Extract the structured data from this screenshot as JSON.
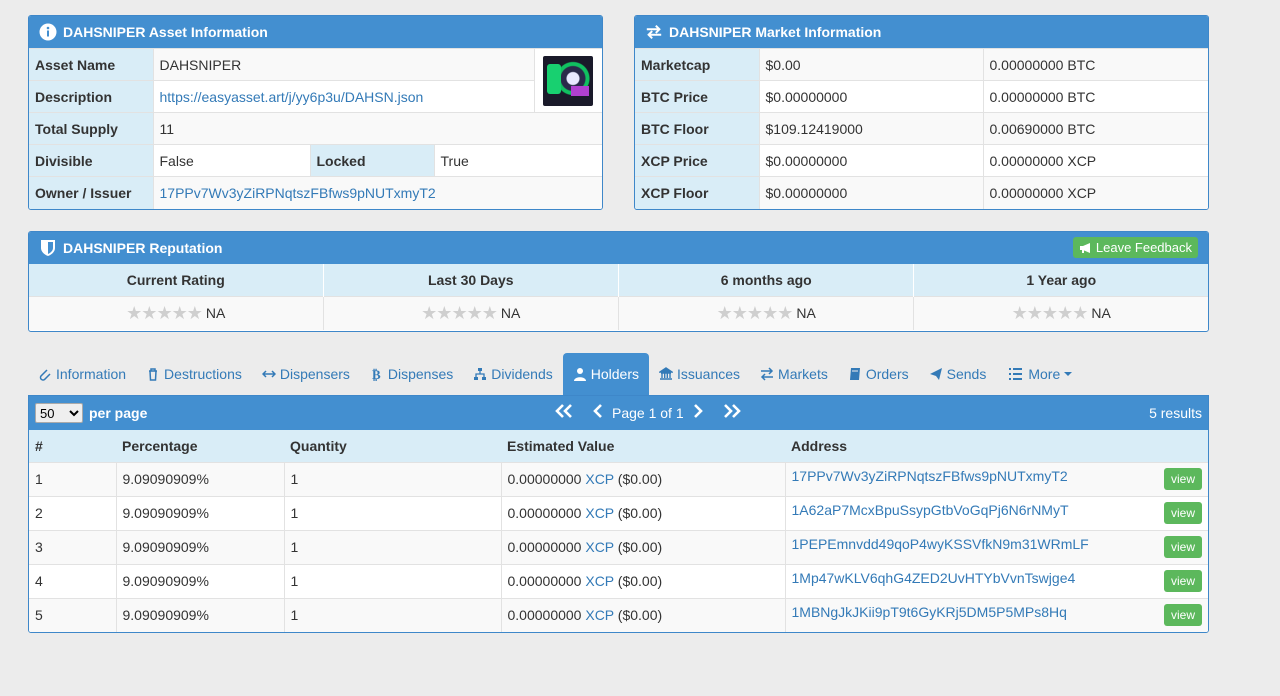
{
  "asset": {
    "title": "DAHSNIPER Asset Information",
    "rows": {
      "name_label": "Asset Name",
      "name": "DAHSNIPER",
      "desc_label": "Description",
      "desc": "https://easyasset.art/j/yy6p3u/DAHSN.json",
      "supply_label": "Total Supply",
      "supply": "11",
      "divisible_label": "Divisible",
      "divisible": "False",
      "locked_label": "Locked",
      "locked": "True",
      "owner_label": "Owner / Issuer",
      "owner": "17PPv7Wv3yZiRPNqtszFBfws9pNUTxmyT2"
    }
  },
  "market": {
    "title": "DAHSNIPER Market Information",
    "rows": [
      {
        "label": "Marketcap",
        "usd": "$0.00",
        "alt": "0.00000000 BTC"
      },
      {
        "label": "BTC Price",
        "usd": "$0.00000000",
        "alt": "0.00000000 BTC"
      },
      {
        "label": "BTC Floor",
        "usd": "$109.12419000",
        "alt": "0.00690000 BTC"
      },
      {
        "label": "XCP Price",
        "usd": "$0.00000000",
        "alt": "0.00000000 XCP"
      },
      {
        "label": "XCP Floor",
        "usd": "$0.00000000",
        "alt": "0.00000000 XCP"
      }
    ]
  },
  "reputation": {
    "title": "DAHSNIPER Reputation",
    "feedback_label": "Leave Feedback",
    "columns": [
      "Current Rating",
      "Last 30 Days",
      "6 months ago",
      "1 Year ago"
    ],
    "values": [
      "NA",
      "NA",
      "NA",
      "NA"
    ]
  },
  "tabs": [
    "Information",
    "Destructions",
    "Dispensers",
    "Dispenses",
    "Dividends",
    "Holders",
    "Issuances",
    "Markets",
    "Orders",
    "Sends",
    "More"
  ],
  "holders": {
    "per_page_value": "50",
    "per_page_label": "per page",
    "page_label": "Page 1 of 1",
    "results": "5 results",
    "headers": [
      "#",
      "Percentage",
      "Quantity",
      "Estimated Value",
      "Address"
    ],
    "view_label": "view",
    "rows": [
      {
        "n": "1",
        "pct": "9.09090909%",
        "qty": "1",
        "val": "0.00000000",
        "asset": "XCP",
        "usd": "($0.00)",
        "addr": "17PPv7Wv3yZiRPNqtszFBfws9pNUTxmyT2"
      },
      {
        "n": "2",
        "pct": "9.09090909%",
        "qty": "1",
        "val": "0.00000000",
        "asset": "XCP",
        "usd": "($0.00)",
        "addr": "1A62aP7McxBpuSsypGtbVoGqPj6N6rNMyT"
      },
      {
        "n": "3",
        "pct": "9.09090909%",
        "qty": "1",
        "val": "0.00000000",
        "asset": "XCP",
        "usd": "($0.00)",
        "addr": "1PEPEmnvdd49qoP4wyKSSVfkN9m31WRmLF"
      },
      {
        "n": "4",
        "pct": "9.09090909%",
        "qty": "1",
        "val": "0.00000000",
        "asset": "XCP",
        "usd": "($0.00)",
        "addr": "1Mp47wKLV6qhG4ZED2UvHTYbVvnTswjge4"
      },
      {
        "n": "5",
        "pct": "9.09090909%",
        "qty": "1",
        "val": "0.00000000",
        "asset": "XCP",
        "usd": "($0.00)",
        "addr": "1MBNgJkJKii9pT9t6GyKRj5DM5P5MPs8Hq"
      }
    ]
  }
}
